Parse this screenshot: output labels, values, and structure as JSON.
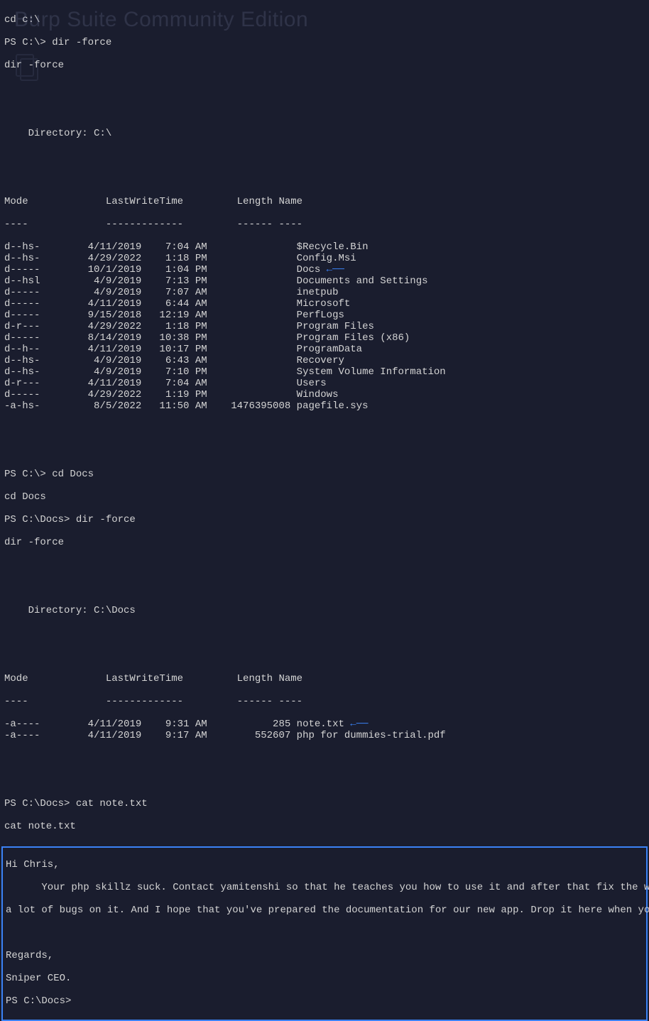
{
  "watermark": "Burp Suite Community Edition",
  "intro": {
    "cd": "cd c:\\",
    "prompt1": "PS C:\\> dir -force",
    "echo1": "dir -force"
  },
  "dir1": {
    "header": "    Directory: C:\\",
    "cols": {
      "mode": "Mode",
      "lwt": "LastWriteTime",
      "len": "Length",
      "name": "Name"
    },
    "underline": {
      "mode": "----",
      "lwt": "-------------",
      "len": "------",
      "name": "----"
    },
    "rows": [
      {
        "mode": "d--hs-",
        "date": "4/11/2019",
        "time": "7:04 AM",
        "len": "",
        "name": "$Recycle.Bin"
      },
      {
        "mode": "d--hs-",
        "date": "4/29/2022",
        "time": "1:18 PM",
        "len": "",
        "name": "Config.Msi"
      },
      {
        "mode": "d-----",
        "date": "10/1/2019",
        "time": "1:04 PM",
        "len": "",
        "name": "Docs",
        "arrow": true
      },
      {
        "mode": "d--hsl",
        "date": "4/9/2019",
        "time": "7:13 PM",
        "len": "",
        "name": "Documents and Settings"
      },
      {
        "mode": "d-----",
        "date": "4/9/2019",
        "time": "7:07 AM",
        "len": "",
        "name": "inetpub"
      },
      {
        "mode": "d-----",
        "date": "4/11/2019",
        "time": "6:44 AM",
        "len": "",
        "name": "Microsoft"
      },
      {
        "mode": "d-----",
        "date": "9/15/2018",
        "time": "12:19 AM",
        "len": "",
        "name": "PerfLogs"
      },
      {
        "mode": "d-r---",
        "date": "4/29/2022",
        "time": "1:18 PM",
        "len": "",
        "name": "Program Files"
      },
      {
        "mode": "d-----",
        "date": "8/14/2019",
        "time": "10:38 PM",
        "len": "",
        "name": "Program Files (x86)"
      },
      {
        "mode": "d--h--",
        "date": "4/11/2019",
        "time": "10:17 PM",
        "len": "",
        "name": "ProgramData"
      },
      {
        "mode": "d--hs-",
        "date": "4/9/2019",
        "time": "6:43 AM",
        "len": "",
        "name": "Recovery"
      },
      {
        "mode": "d--hs-",
        "date": "4/9/2019",
        "time": "7:10 PM",
        "len": "",
        "name": "System Volume Information"
      },
      {
        "mode": "d-r---",
        "date": "4/11/2019",
        "time": "7:04 AM",
        "len": "",
        "name": "Users"
      },
      {
        "mode": "d-----",
        "date": "4/29/2022",
        "time": "1:19 PM",
        "len": "",
        "name": "Windows"
      },
      {
        "mode": "-a-hs-",
        "date": "8/5/2022",
        "time": "11:50 AM",
        "len": "1476395008",
        "name": "pagefile.sys"
      }
    ]
  },
  "mid": {
    "prompt1": "PS C:\\> cd Docs",
    "echo1": "cd Docs",
    "prompt2": "PS C:\\Docs> dir -force",
    "echo2": "dir -force"
  },
  "dir2": {
    "header": "    Directory: C:\\Docs",
    "cols": {
      "mode": "Mode",
      "lwt": "LastWriteTime",
      "len": "Length",
      "name": "Name"
    },
    "underline": {
      "mode": "----",
      "lwt": "-------------",
      "len": "------",
      "name": "----"
    },
    "rows": [
      {
        "mode": "-a----",
        "date": "4/11/2019",
        "time": "9:31 AM",
        "len": "285",
        "name": "note.txt",
        "arrow": true
      },
      {
        "mode": "-a----",
        "date": "4/11/2019",
        "time": "9:17 AM",
        "len": "552607",
        "name": "php for dummies-trial.pdf"
      }
    ]
  },
  "cat": {
    "prompt": "PS C:\\Docs> cat note.txt",
    "echo": "cat note.txt"
  },
  "note": {
    "l1": "Hi Chris,",
    "l2": "      Your php skillz suck. Contact yamitenshi so that he teaches you how to use it and after that fix the website as there are",
    "l3": "a lot of bugs on it. And I hope that you've prepared the documentation for our new app. Drop it here when you're done with it.",
    "l4": "",
    "l5": "Regards,",
    "l6": "Sniper CEO.",
    "prompt": "PS C:\\Docs>"
  }
}
